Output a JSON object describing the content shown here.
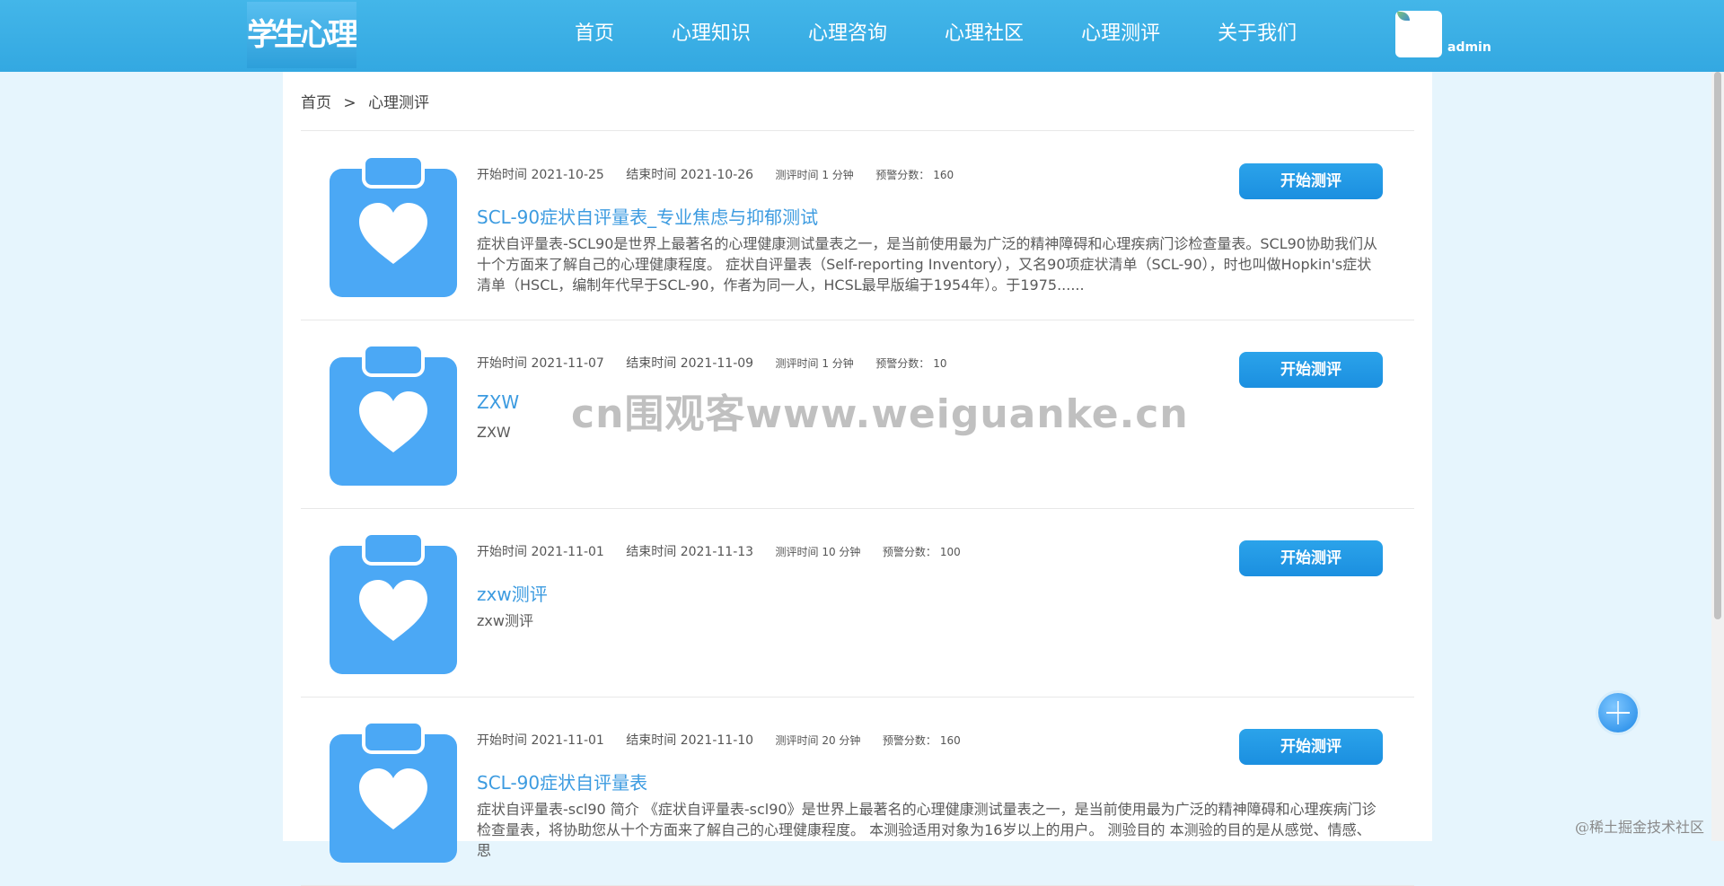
{
  "logo": {
    "text": "学生心理健康"
  },
  "nav": {
    "items": [
      "首页",
      "心理知识",
      "心理咨询",
      "心理社区",
      "心理测评",
      "关于我们"
    ]
  },
  "user": {
    "name": "admin"
  },
  "breadcrumb": {
    "home": "首页",
    "separator": ">",
    "current": "心理测评"
  },
  "assessments": [
    {
      "start": "开始时间 2021-10-25",
      "end": "结束时间 2021-10-26",
      "duration": "测评时间 1 分钟",
      "warning_label": "预警分数：",
      "warning_value": "160",
      "title": "SCL-90症状自评量表_专业焦虑与抑郁测试",
      "description": "症状自评量表-SCL90是世界上最著名的心理健康测试量表之一，是当前使用最为广泛的精神障碍和心理疾病门诊检查量表。SCL90协助我们从十个方面来了解自己的心理健康程度。 症状自评量表（Self-reporting Inventory），又名90项症状清单（SCL-90），时也叫做Hopkin's症状清单（HSCL，编制年代早于SCL-90，作者为同一人，HCSL最早版编于1954年）。于1975......",
      "button": "开始测评"
    },
    {
      "start": "开始时间 2021-11-07",
      "end": "结束时间 2021-11-09",
      "duration": "测评时间 1 分钟",
      "warning_label": "预警分数：",
      "warning_value": "10",
      "title": "ZXW",
      "description": "ZXW",
      "button": "开始测评"
    },
    {
      "start": "开始时间 2021-11-01",
      "end": "结束时间 2021-11-13",
      "duration": "测评时间 10 分钟",
      "warning_label": "预警分数：",
      "warning_value": "100",
      "title": "zxw测评",
      "description": "zxw测评",
      "button": "开始测评"
    },
    {
      "start": "开始时间 2021-11-01",
      "end": "结束时间 2021-11-10",
      "duration": "测评时间 20 分钟",
      "warning_label": "预警分数：",
      "warning_value": "160",
      "title": "SCL-90症状自评量表",
      "description": "症状自评量表-scl90 简介 《症状自评量表-scl90》是世界上最著名的心理健康测试量表之一，是当前使用最为广泛的精神障碍和心理疾病门诊检查量表，将协助您从十个方面来了解自己的心理健康程度。 本测验适用对象为16岁以上的用户。 测验目的 本测验的目的是从感觉、情感、思",
      "button": "开始测评"
    }
  ],
  "watermark": {
    "text": "cn围观客www.weiguanke.cn"
  },
  "corner_mark": {
    "text": "@稀土掘金技术社区"
  },
  "colors": {
    "header": "#36abe3",
    "accent": "#1e93e3",
    "title": "#3c9be0",
    "icon": "#4ba8f5",
    "page_bg": "#e6f5fd"
  },
  "icons": {
    "assessment": "clipboard-heart-icon",
    "float": "float-action-icon"
  }
}
